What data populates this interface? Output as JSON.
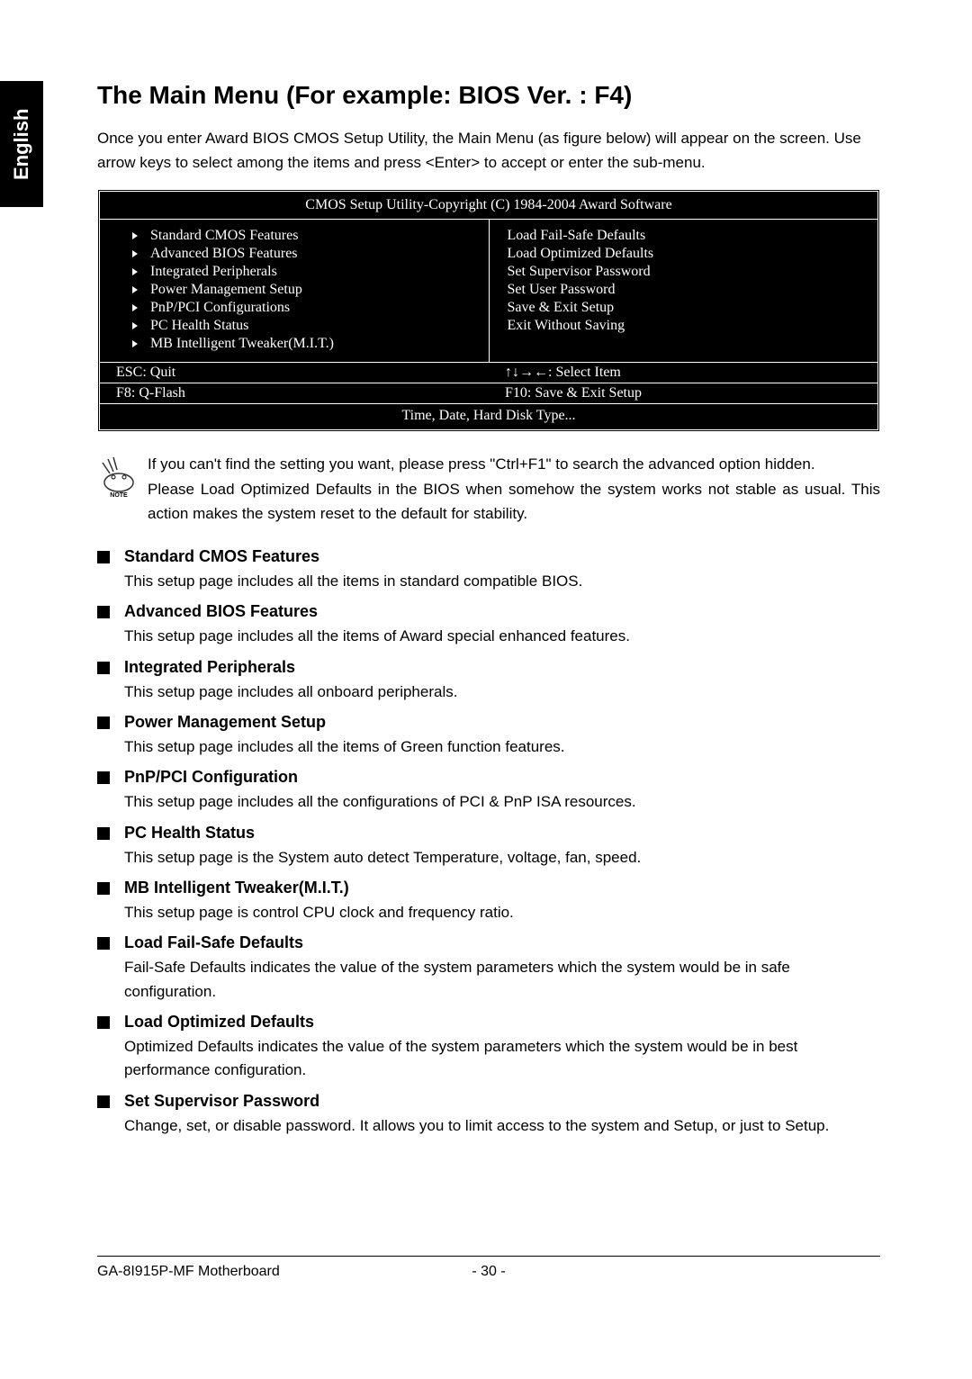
{
  "sidebar": {
    "language": "English"
  },
  "page": {
    "title": "The Main Menu (For example: BIOS Ver. : F4)",
    "intro": "Once you enter Award BIOS CMOS Setup Utility, the Main Menu (as figure below) will appear on the screen. Use arrow keys to select among the items and press <Enter> to accept or enter the sub-menu."
  },
  "bios": {
    "header": "CMOS Setup Utility-Copyright (C) 1984-2004 Award Software",
    "left_items": [
      "Standard CMOS Features",
      "Advanced BIOS Features",
      "Integrated Peripherals",
      "Power Management Setup",
      "PnP/PCI Configurations",
      "PC Health Status",
      "MB Intelligent Tweaker(M.I.T.)"
    ],
    "right_items": [
      "Load Fail-Safe Defaults",
      "Load Optimized Defaults",
      "Set Supervisor Password",
      "Set User Password",
      "Save & Exit Setup",
      "Exit Without Saving"
    ],
    "footer": {
      "esc": "ESC: Quit",
      "arrows": "↑↓→←: Select Item",
      "f8": "F8: Q-Flash",
      "f10": "F10: Save & Exit Setup"
    },
    "help": "Time, Date, Hard Disk Type..."
  },
  "note": {
    "label": "NOTE",
    "text1": "If you can't find the setting you want, please press \"Ctrl+F1\" to search the advanced option hidden.",
    "text2": "Please Load Optimized Defaults in the BIOS when somehow the system works not stable as usual. This action makes the system reset to the default for stability."
  },
  "sections": [
    {
      "title": "Standard CMOS Features",
      "desc": "This setup page includes all the items in standard compatible BIOS."
    },
    {
      "title": "Advanced BIOS Features",
      "desc": "This setup page includes all the items of Award special enhanced features."
    },
    {
      "title": "Integrated Peripherals",
      "desc": "This setup page includes all onboard peripherals."
    },
    {
      "title": "Power Management Setup",
      "desc": "This setup page includes all the items of Green function features."
    },
    {
      "title": "PnP/PCI Configuration",
      "desc": "This setup page includes all the configurations of PCI & PnP ISA resources."
    },
    {
      "title": "PC Health Status",
      "desc": "This setup page is the System auto detect Temperature, voltage, fan, speed."
    },
    {
      "title": "MB Intelligent Tweaker(M.I.T.)",
      "desc": "This setup page is control CPU clock and frequency ratio."
    },
    {
      "title": "Load Fail-Safe Defaults",
      "desc": "Fail-Safe Defaults indicates the value of the system parameters which the system would be in safe configuration."
    },
    {
      "title": "Load Optimized Defaults",
      "desc": "Optimized Defaults indicates the value of the system parameters which the system would be in best performance configuration."
    },
    {
      "title": "Set Supervisor Password",
      "desc": "Change, set, or disable password. It allows you to limit access to the system and Setup, or just to Setup."
    }
  ],
  "footer": {
    "product": "GA-8I915P-MF Motherboard",
    "page": "- 30 -"
  }
}
